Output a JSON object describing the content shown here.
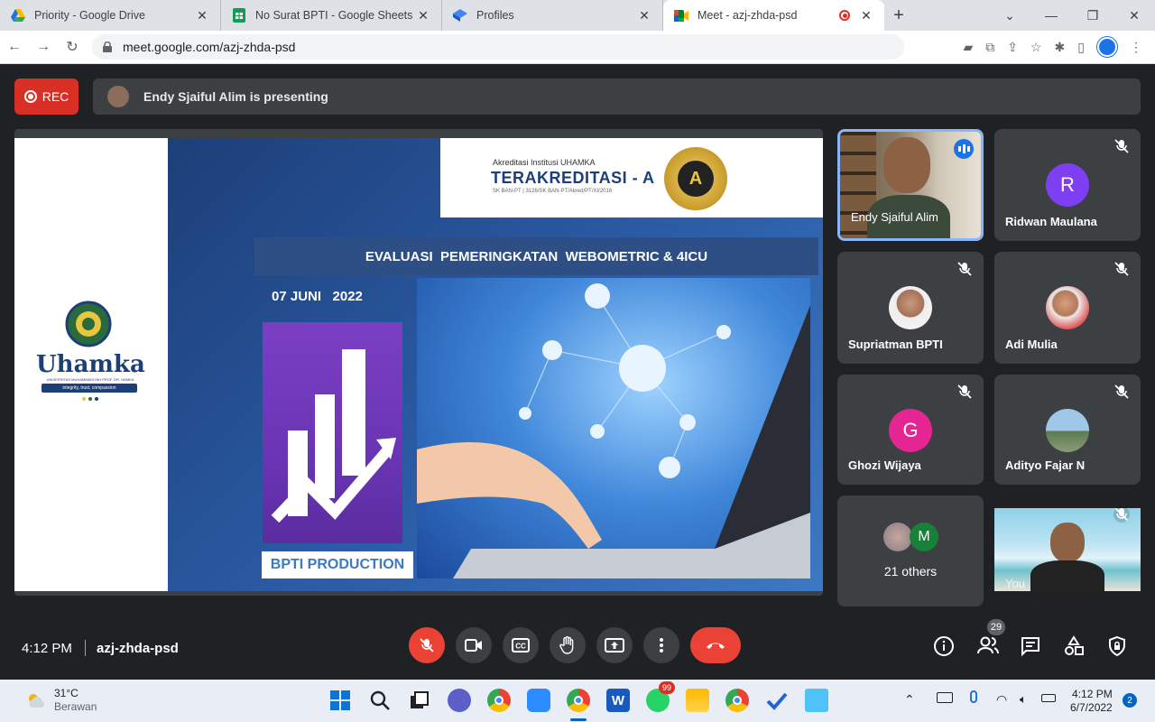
{
  "browser": {
    "tabs": [
      {
        "title": "Priority - Google Drive",
        "icon": "drive-icon"
      },
      {
        "title": "No Surat BPTI - Google Sheets",
        "icon": "sheets-icon"
      },
      {
        "title": "Profiles",
        "icon": "profiles-icon"
      },
      {
        "title": "Meet - azj-zhda-psd",
        "icon": "meet-icon",
        "active": true
      }
    ],
    "url": "meet.google.com/azj-zhda-psd"
  },
  "meet": {
    "rec_label": "REC",
    "presenting_text": "Endy Sjaiful Alim is presenting",
    "slide": {
      "accreditation_small": "Akreditasi Institusi UHAMKA",
      "accreditation_big": "TERAKREDITASI - A",
      "accreditation_sk": "SK BAN-PT | 3126/SK BAN-PT/Akred/PT/XI/2016",
      "badge_letter": "A",
      "headline": "EVALUASI  PEMERINGKATAN  WEBOMETRIC & 4ICU",
      "date": "07 JUNI   2022",
      "production": "BPTI PRODUCTION",
      "logo_text": "Uhamka",
      "logo_sub": "UNIVERSITAS MUHAMMADIYAH PROF. DR. HAMKA",
      "logo_tag": "integrity, trust, compassion"
    },
    "participants": [
      {
        "name": "Endy Sjaiful Alim",
        "type": "video"
      },
      {
        "name": "Ridwan Maulana",
        "initial": "R",
        "color": "#7e3ff2"
      },
      {
        "name": "Supriatman BPTI",
        "type": "photo"
      },
      {
        "name": "Adi Mulia",
        "type": "photo"
      },
      {
        "name": "Ghozi Wijaya",
        "initial": "G",
        "color": "#e52592"
      },
      {
        "name": "Adityo Fajar N",
        "type": "photo"
      },
      {
        "name": "21 others",
        "initial": "M",
        "color": "#188038"
      },
      {
        "name": "You",
        "type": "video"
      }
    ],
    "time": "4:12 PM",
    "code": "azj-zhda-psd",
    "people_count": "29"
  },
  "taskbar": {
    "weather_temp": "31°C",
    "weather_desc": "Berawan",
    "whatsapp_badge": "99",
    "clock_time": "4:12 PM",
    "clock_date": "6/7/2022",
    "notif_count": "2"
  }
}
